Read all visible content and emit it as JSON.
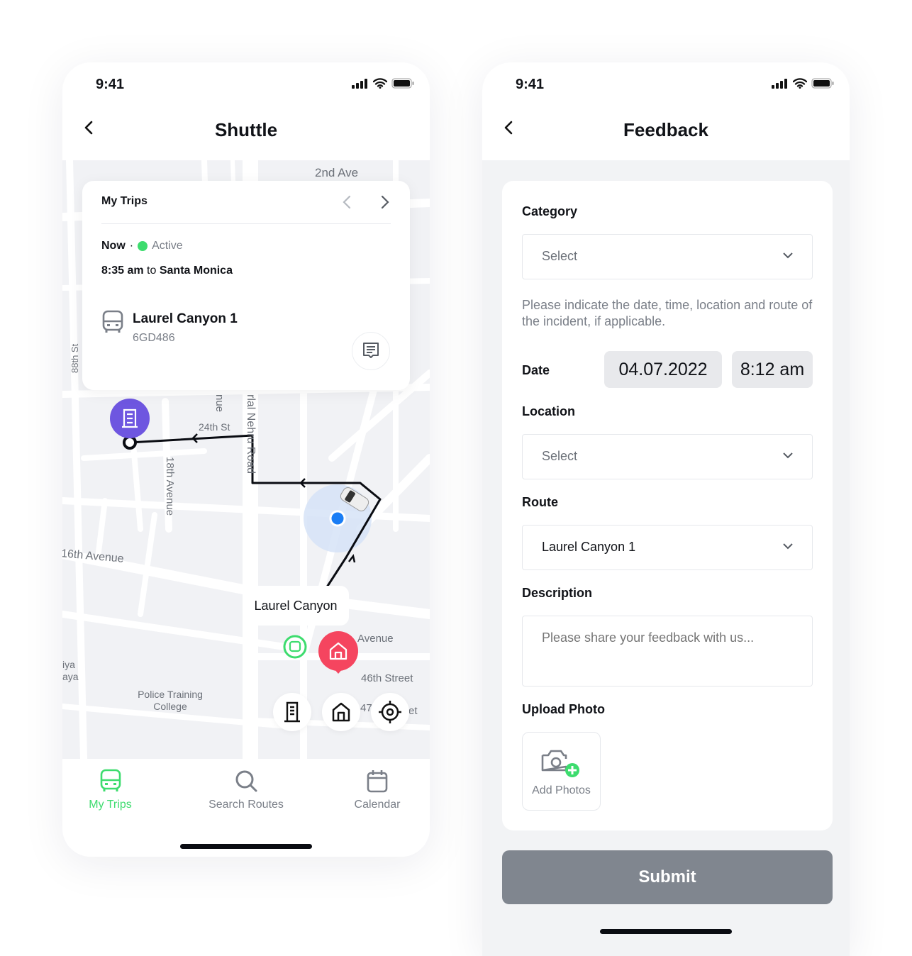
{
  "colors": {
    "accent": "#3ddc6e",
    "primary_pin": "#6e56e0",
    "home_pin": "#f5455f",
    "location": "#1a7df5",
    "submit_bg": "#80868f"
  },
  "shuttle": {
    "status_time": "9:41",
    "title": "Shuttle",
    "map_labels": {
      "street_2nd": "2nd Ave",
      "street_88": "88th St",
      "street_ue": "nue",
      "street_nehru": "rlal Nehru Road",
      "street_24": "24th St",
      "street_18": "18th Avenue",
      "street_16": "16th Avenue",
      "street_avenue": "Avenue",
      "street_46": "46th Street",
      "street_47": "47",
      "street_et": "et",
      "place_iya": "iya",
      "place_aya": "aya",
      "place_police": "Police Training",
      "place_college": "College"
    },
    "stop_label": "Laurel Canyon",
    "trip_card": {
      "heading": "My Trips",
      "when": "Now",
      "separator": "·",
      "status": "Active",
      "time": "8:35 am",
      "to": "to",
      "destination": "Santa Monica",
      "route_name": "Laurel Canyon 1",
      "plate": "6GD486"
    },
    "nav": [
      {
        "label": "My Trips",
        "icon": "bus-icon",
        "active": true
      },
      {
        "label": "Search Routes",
        "icon": "search-icon",
        "active": false
      },
      {
        "label": "Calendar",
        "icon": "calendar-icon",
        "active": false
      }
    ]
  },
  "feedback": {
    "status_time": "9:41",
    "title": "Feedback",
    "category": {
      "label": "Category",
      "value": "Select"
    },
    "hint": "Please indicate the date, time, location and route of the incident, if applicable.",
    "date": {
      "label": "Date",
      "date": "04.07.2022",
      "time": "8:12 am"
    },
    "location": {
      "label": "Location",
      "value": "Select"
    },
    "route": {
      "label": "Route",
      "value": "Laurel Canyon 1"
    },
    "description": {
      "label": "Description",
      "placeholder": "Please share your feedback with us..."
    },
    "upload": {
      "label": "Upload Photo",
      "button": "Add Photos"
    },
    "submit": "Submit"
  }
}
